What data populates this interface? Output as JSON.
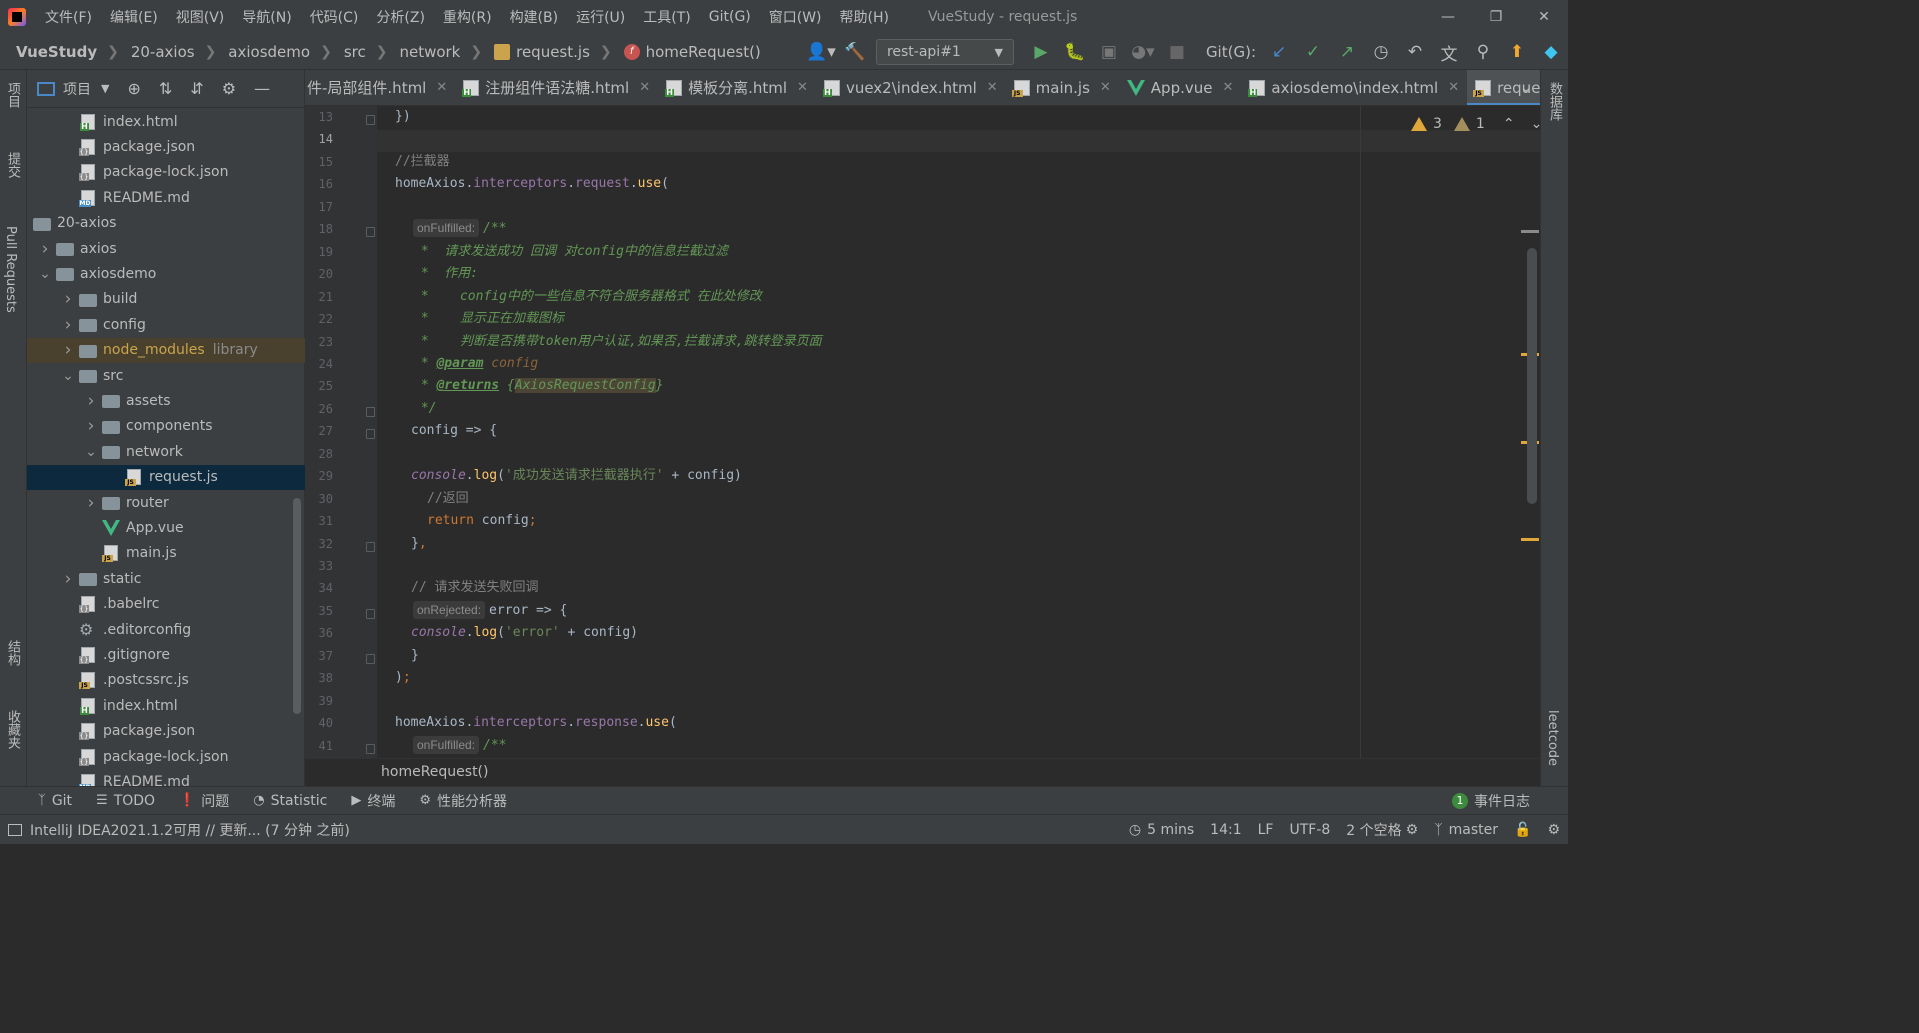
{
  "menu": {
    "items": [
      "文件(F)",
      "编辑(E)",
      "视图(V)",
      "导航(N)",
      "代码(C)",
      "分析(Z)",
      "重构(R)",
      "构建(B)",
      "运行(U)",
      "工具(T)",
      "Git(G)",
      "窗口(W)",
      "帮助(H)"
    ],
    "window_title": "VueStudy - request.js"
  },
  "navbar": {
    "crumbs": [
      "VueStudy",
      "20-axios",
      "axiosdemo",
      "src",
      "network",
      "request.js",
      "homeRequest()"
    ],
    "run_config": "rest-api#1",
    "git_label": "Git(G):"
  },
  "left_stripe": {
    "project": "项目",
    "commit": "提交",
    "pull_requests": "Pull Requests",
    "structure": "结构",
    "favorites": "收藏夹"
  },
  "right_stripe": {
    "database": "数据库",
    "leetcode": "leetcode"
  },
  "project_panel": {
    "title": "项目",
    "tree": [
      {
        "name": "index.html",
        "type": "html"
      },
      {
        "name": "package.json",
        "type": "json"
      },
      {
        "name": "package-lock.json",
        "type": "json"
      },
      {
        "name": "README.md",
        "type": "md"
      },
      {
        "name": "20-axios",
        "type": "folder",
        "expanded": true
      },
      {
        "name": "axios",
        "type": "folder"
      },
      {
        "name": "axiosdemo",
        "type": "folder",
        "expanded": true
      },
      {
        "name": "build",
        "type": "folder"
      },
      {
        "name": "config",
        "type": "folder"
      },
      {
        "name": "node_modules",
        "type": "folder",
        "extra": "library"
      },
      {
        "name": "src",
        "type": "folder",
        "expanded": true
      },
      {
        "name": "assets",
        "type": "folder"
      },
      {
        "name": "components",
        "type": "folder"
      },
      {
        "name": "network",
        "type": "folder",
        "expanded": true
      },
      {
        "name": "request.js",
        "type": "js",
        "selected": true
      },
      {
        "name": "router",
        "type": "folder"
      },
      {
        "name": "App.vue",
        "type": "vue"
      },
      {
        "name": "main.js",
        "type": "js"
      },
      {
        "name": "static",
        "type": "folder"
      },
      {
        "name": ".babelrc",
        "type": "json"
      },
      {
        "name": ".editorconfig",
        "type": "gear"
      },
      {
        "name": ".gitignore",
        "type": "json"
      },
      {
        "name": ".postcssrc.js",
        "type": "js"
      },
      {
        "name": "index.html",
        "type": "html"
      },
      {
        "name": "package.json",
        "type": "json"
      },
      {
        "name": "package-lock.json",
        "type": "json"
      },
      {
        "name": "README.md",
        "type": "md"
      }
    ]
  },
  "editor_tabs": [
    {
      "label": "件-局部组件.html",
      "type": "none"
    },
    {
      "label": "注册组件语法糖.html",
      "type": "html"
    },
    {
      "label": "模板分离.html",
      "type": "html"
    },
    {
      "label": "vuex2\\index.html",
      "type": "html"
    },
    {
      "label": "main.js",
      "type": "js"
    },
    {
      "label": "App.vue",
      "type": "vue"
    },
    {
      "label": "axiosdemo\\index.html",
      "type": "html"
    },
    {
      "label": "request.js",
      "type": "js",
      "active": true
    }
  ],
  "editor": {
    "line_numbers": [
      "13",
      "14",
      "15",
      "16",
      "17",
      "18",
      "19",
      "20",
      "21",
      "22",
      "23",
      "24",
      "25",
      "26",
      "27",
      "28",
      "29",
      "30",
      "31",
      "32",
      "33",
      "34",
      "35",
      "36",
      "37",
      "38",
      "39",
      "40",
      "41"
    ],
    "current_line": "14",
    "warnings_count": "3",
    "weak_warnings_count": "1",
    "breadcrumb": "homeRequest()",
    "code": {
      "l13": "})",
      "l15": "//拦截器",
      "l16_obj": "homeAxios",
      "l16_prop": "interceptors",
      "l16_prop2": "request",
      "l16_fn": "use",
      "hint_fulfilled": "onFulfilled:",
      "l18_doc": "/**",
      "l19": " *  请求发送成功 回调 对config中的信息拦截过滤",
      "l20": " *  作用:",
      "l21": " *    config中的一些信息不符合服务器格式 在此处修改",
      "l22": " *    显示正在加载图标",
      "l23": " *    判断是否携带token用户认证,如果否,拦截请求,跳转登录页面",
      "l24_tag": "@param",
      "l24_param": "config",
      "l25_tag": "@returns",
      "l25_type": "AxiosRequestConfig",
      "l26": " */",
      "l27": "config => {",
      "l29_glob": "console",
      "l29_fn": "log",
      "l29_str": "'成功发送请求拦截器执行'",
      "l29_rest": " + config)",
      "l30": "//返回",
      "l31_kw": "return",
      "l31_rest": " config",
      "l32": "},",
      "l34": "// 请求发送失败回调",
      "hint_rejected": "onRejected:",
      "l35_rest": "error => {",
      "l36_str": "'error'",
      "l36_rest": " + config)",
      "l37": "}",
      "l38": ");",
      "l40_prop2": "response",
      "l41_doc": "/**"
    }
  },
  "tool_strip": [
    "Git",
    "TODO",
    "问题",
    "Statistic",
    "终端",
    "性能分析器"
  ],
  "event_log": {
    "count": "1",
    "label": "事件日志"
  },
  "statusbar": {
    "message": "IntelliJ IDEA2021.1.2可用 // 更新... (7 分钟 之前)",
    "time": "5 mins",
    "position": "14:1",
    "line_sep": "LF",
    "encoding": "UTF-8",
    "indent": "2 个空格",
    "branch": "master"
  }
}
